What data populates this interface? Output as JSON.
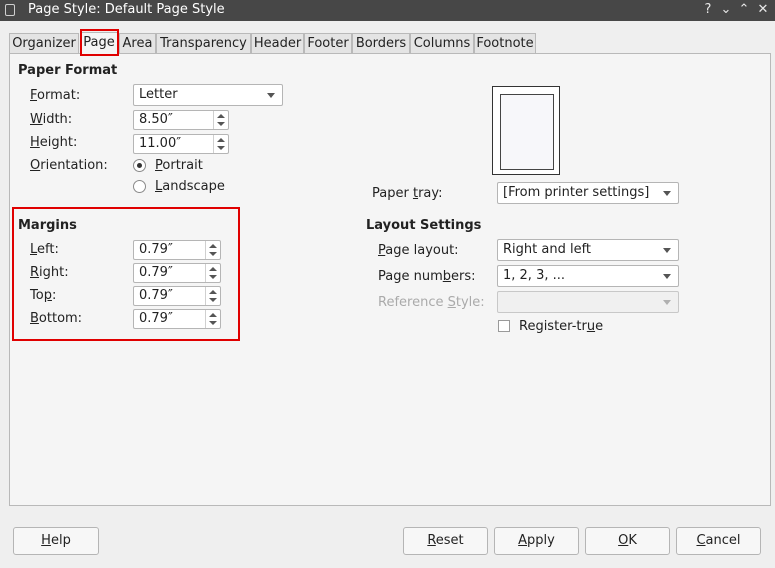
{
  "window": {
    "title": "Page Style: Default Page Style",
    "help_glyph": "?",
    "minimize_glyph": "⌄",
    "maximize_glyph": "⌃",
    "close_glyph": "✕"
  },
  "tabs": [
    {
      "label": "Organizer"
    },
    {
      "label": "Page",
      "active": true
    },
    {
      "label": "Area"
    },
    {
      "label": "Transparency"
    },
    {
      "label": "Header"
    },
    {
      "label": "Footer"
    },
    {
      "label": "Borders"
    },
    {
      "label": "Columns"
    },
    {
      "label": "Footnote"
    }
  ],
  "paper_format": {
    "title": "Paper Format",
    "format": {
      "label_accel": "F",
      "label_rest": "ormat:",
      "value": "Letter"
    },
    "width": {
      "label_accel": "W",
      "label_rest": "idth:",
      "value": "8.50″"
    },
    "height": {
      "label_accel": "H",
      "label_rest": "eight:",
      "value": "11.00″"
    },
    "orientation": {
      "label_accel": "O",
      "label_rest": "rientation:",
      "portrait_accel": "P",
      "portrait_rest": "ortrait",
      "landscape_accel": "L",
      "landscape_rest": "andscape",
      "selected": "Portrait"
    },
    "paper_tray": {
      "label_pre": "Paper ",
      "label_accel": "t",
      "label_rest": "ray:",
      "value": "[From printer settings]"
    }
  },
  "margins": {
    "title": "Margins",
    "left": {
      "label_accel": "L",
      "label_rest": "eft:",
      "value": "0.79″"
    },
    "right": {
      "label_accel": "R",
      "label_rest": "ight:",
      "value": "0.79″"
    },
    "top": {
      "label_pre": "To",
      "label_accel": "p",
      "label_rest": ":",
      "value": "0.79″"
    },
    "bottom": {
      "label_accel": "B",
      "label_rest": "ottom:",
      "value": "0.79″"
    }
  },
  "layout_settings": {
    "title": "Layout Settings",
    "page_layout": {
      "label_accel": "P",
      "label_rest": "age layout:",
      "value": "Right and left"
    },
    "page_numbers": {
      "label_pre": "Page num",
      "label_accel": "b",
      "label_rest": "ers:",
      "value": "1, 2, 3, ..."
    },
    "reference_style": {
      "label_pre": "Reference ",
      "label_accel": "S",
      "label_rest": "tyle:",
      "value": ""
    },
    "register_true": {
      "label_pre": "Register-tr",
      "label_accel": "u",
      "label_rest": "e",
      "checked": false
    }
  },
  "buttons": {
    "help": {
      "accel": "H",
      "rest": "elp"
    },
    "reset": {
      "accel": "R",
      "rest": "eset"
    },
    "apply": {
      "accel": "A",
      "rest": "pply"
    },
    "ok": {
      "accel": "O",
      "rest": "K"
    },
    "cancel": {
      "accel": "C",
      "rest": "ancel"
    }
  },
  "colors": {
    "highlight": "#e00000",
    "titlebar": "#474747"
  }
}
